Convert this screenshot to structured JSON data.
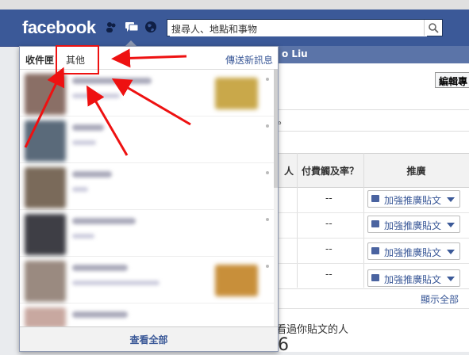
{
  "header": {
    "logo": "facebook",
    "search_placeholder": "搜尋人、地點和事物",
    "search_value": "搜尋人、地點和事物",
    "profile_partial": "o Liu"
  },
  "dropdown": {
    "tab_inbox": "收件匣",
    "tab_other": "其他",
    "send_new": "傳送新訊息",
    "view_all": "查看全部",
    "messages": [
      {
        "avatar_color": "#8a6f66",
        "thumb_color": "#c9a84a"
      },
      {
        "avatar_color": "#5a6a7a"
      },
      {
        "avatar_color": "#7a6a5a"
      },
      {
        "avatar_color": "#3e3e45"
      },
      {
        "avatar_color": "#9a8a80",
        "thumb_color": "#c88f3a"
      },
      {
        "avatar_color": "#c8a8a0"
      }
    ]
  },
  "right_panel": {
    "edit_button": "編輯專",
    "col_paid_reach": "付費觸及率？",
    "col_promote": "推廣",
    "col_partial": "人",
    "rows": [
      {
        "reach": "--",
        "promote": "加強推廣貼文"
      },
      {
        "reach": "--",
        "promote": "加強推廣貼文"
      },
      {
        "reach": "--",
        "promote": "加強推廣貼文"
      },
      {
        "reach": "--",
        "promote": "加強推廣貼文"
      }
    ],
    "show_all": "顯示全部",
    "seen_text": "看過你貼文的人",
    "seen_number": "6"
  },
  "colors": {
    "brand": "#3b5998",
    "annotation": "#e11111"
  }
}
